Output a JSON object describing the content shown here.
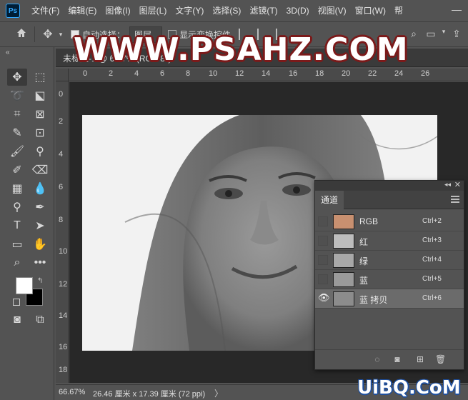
{
  "menu": {
    "logo": "Ps",
    "items": [
      "文件(F)",
      "编辑(E)",
      "图像(I)",
      "图层(L)",
      "文字(Y)",
      "选择(S)",
      "滤镜(T)",
      "3D(D)",
      "视图(V)",
      "窗口(W)",
      "帮"
    ],
    "minimize": "—"
  },
  "options": {
    "auto_select_label": "自动选择：",
    "auto_select_value": "图层",
    "show_transform_label": "显示变换控件"
  },
  "document": {
    "title": "未标题-1 @ 66.7% (RGB/8*)"
  },
  "ruler": {
    "h_ticks": [
      "0",
      "2",
      "4",
      "6",
      "8",
      "10",
      "12",
      "14",
      "16",
      "18",
      "20",
      "22",
      "24",
      "26"
    ],
    "v_ticks": [
      "0",
      "2",
      "4",
      "6",
      "8",
      "10",
      "12",
      "14",
      "16",
      "18"
    ]
  },
  "status": {
    "zoom": "66.67%",
    "size": "26.46 厘米 x 17.39 厘米 (72 ppi)",
    "arrow": "〉"
  },
  "channels_panel": {
    "tab_label": "通道",
    "rows": [
      {
        "name": "RGB",
        "shortcut": "Ctrl+2",
        "visible": false,
        "selected": false
      },
      {
        "name": "红",
        "shortcut": "Ctrl+3",
        "visible": false,
        "selected": false
      },
      {
        "name": "绿",
        "shortcut": "Ctrl+4",
        "visible": false,
        "selected": false
      },
      {
        "name": "蓝",
        "shortcut": "Ctrl+5",
        "visible": false,
        "selected": false
      },
      {
        "name": "蓝 拷贝",
        "shortcut": "Ctrl+6",
        "visible": true,
        "selected": true
      }
    ]
  },
  "watermark": {
    "top": "WWW.PSAHZ.COM",
    "bottom": "UiBQ.CoM"
  },
  "colors": {
    "foreground": "#ffffff",
    "background": "#000000",
    "accent_logo": "#31a8ff"
  }
}
